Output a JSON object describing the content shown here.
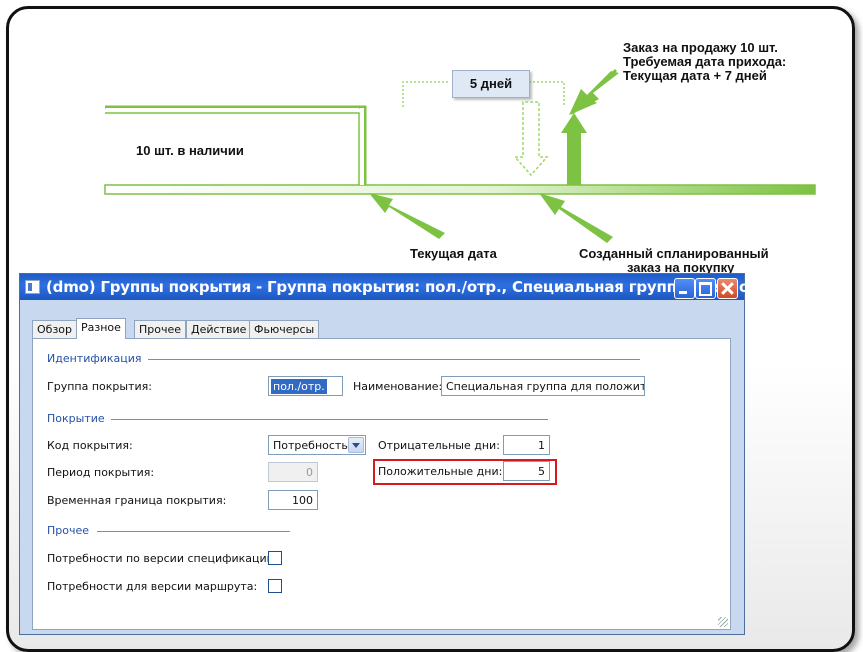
{
  "diagram": {
    "sales_order_line1": "Заказ на продажу 10 шт.",
    "sales_order_line2": "Требуемая дата прихода:",
    "sales_order_line3": "Текущая дата + 7 дней",
    "days": "5 дней",
    "in_stock": "10 шт. в наличии",
    "current_date": "Текущая дата",
    "planned_order_line1": "Созданный спланированный",
    "planned_order_line2": "заказ на покупку",
    "colors": {
      "arrow": "#7dc242",
      "dotted": "#9fd86a"
    }
  },
  "window": {
    "title": "(dmo) Группы покрытия - Группа покрытия: пол./отр., Специальная группа для полож...",
    "tabs": [
      "Обзор",
      "Разное",
      "Прочее",
      "Действие",
      "Фьючерсы"
    ],
    "active_tab": "Разное",
    "sections": {
      "identification": "Идентификация",
      "coverage": "Покрытие",
      "other": "Прочее"
    },
    "fields": {
      "coverage_group_label": "Группа покрытия:",
      "coverage_group_value": "пол./отр.",
      "name_label": "Наименование:",
      "name_value": "Специальная группа для положите",
      "coverage_code_label": "Код покрытия:",
      "coverage_code_value": "Потребность",
      "coverage_period_label": "Период покрытия:",
      "coverage_period_value": "0",
      "time_fence_label": "Временная граница покрытия:",
      "time_fence_value": "100",
      "negative_days_label": "Отрицательные дни:",
      "negative_days_value": "1",
      "positive_days_label": "Положительные дни:",
      "positive_days_value": "5",
      "bom_version_label": "Потребности по версии спецификации:",
      "route_version_label": "Потребности для версии маршрута:"
    },
    "highlight_color": "#d6191e"
  }
}
